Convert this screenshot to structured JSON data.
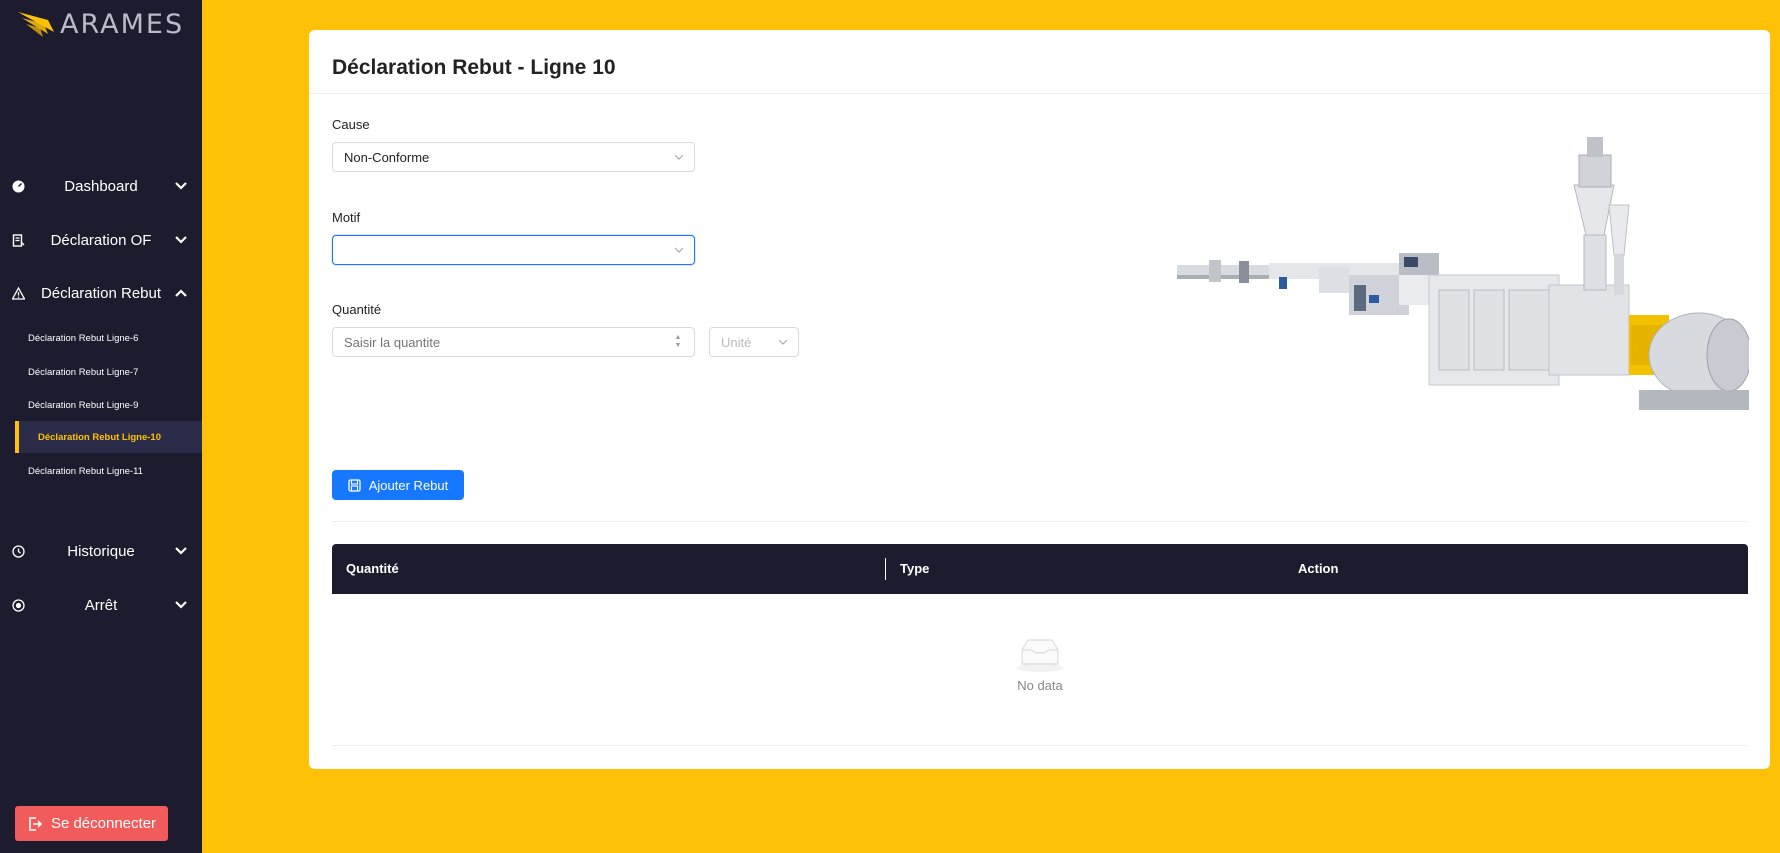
{
  "sidebar": {
    "logo_text": "ARAMES",
    "nav": [
      {
        "label": "Dashboard",
        "icon": "dashboard-icon",
        "expanded": false
      },
      {
        "label": "Déclaration OF",
        "icon": "document-icon",
        "expanded": false
      },
      {
        "label": "Déclaration Rebut",
        "icon": "warning-icon",
        "expanded": true
      },
      {
        "label": "Historique",
        "icon": "history-icon",
        "expanded": false
      },
      {
        "label": "Arrêt",
        "icon": "stop-icon",
        "expanded": false
      }
    ],
    "sub_items": [
      {
        "label": "Déclaration Rebut Ligne-6",
        "active": false
      },
      {
        "label": "Déclaration Rebut Ligne-7",
        "active": false
      },
      {
        "label": "Déclaration Rebut Ligne-9",
        "active": false
      },
      {
        "label": "Déclaration Rebut Ligne-10",
        "active": true
      },
      {
        "label": "Déclaration Rebut Ligne-11",
        "active": false
      }
    ],
    "logout_label": "Se déconnecter"
  },
  "form": {
    "title": "Déclaration Rebut - Ligne 10",
    "cause": {
      "label": "Cause",
      "value": "Non-Conforme"
    },
    "motif": {
      "label": "Motif",
      "value": ""
    },
    "quantite": {
      "label": "Quantité",
      "placeholder": "Saisir la quantite",
      "unit_placeholder": "Unité"
    },
    "add_button": "Ajouter Rebut"
  },
  "table": {
    "columns": [
      "Quantité",
      "Type",
      "Action"
    ],
    "rows": [],
    "empty_text": "No data"
  },
  "colors": {
    "background": "#FFC107",
    "sidebar": "#1c1c2e",
    "accent": "#FFC107",
    "primary": "#1677ff",
    "logout": "#f25b5b"
  }
}
